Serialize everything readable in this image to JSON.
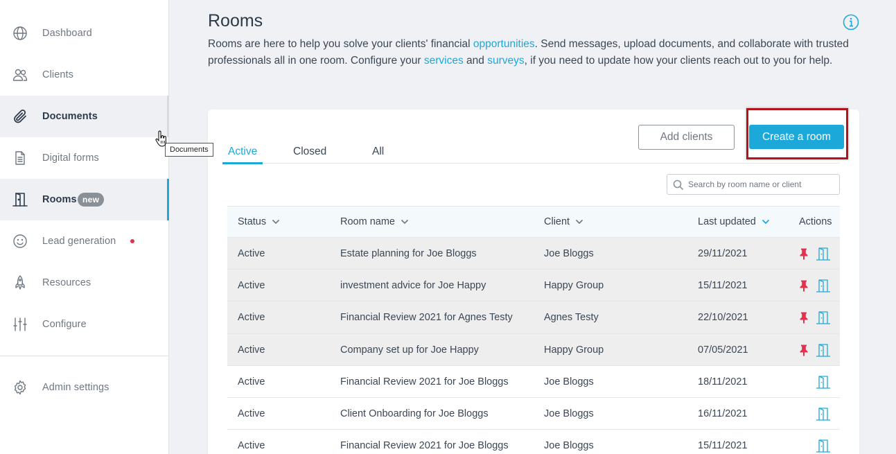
{
  "sidebar": {
    "items": [
      {
        "key": "dashboard",
        "label": "Dashboard",
        "icon": "globe-icon"
      },
      {
        "key": "clients",
        "label": "Clients",
        "icon": "users-icon"
      },
      {
        "key": "documents",
        "label": "Documents",
        "icon": "paperclip-icon",
        "state": "hover"
      },
      {
        "key": "digital-forms",
        "label": "Digital forms",
        "icon": "document-icon"
      },
      {
        "key": "rooms",
        "label": "Rooms",
        "icon": "door-icon",
        "state": "active",
        "badge": "new"
      },
      {
        "key": "lead-generation",
        "label": "Lead generation",
        "icon": "smiley-icon",
        "dot": true
      },
      {
        "key": "resources",
        "label": "Resources",
        "icon": "rocket-icon"
      },
      {
        "key": "configure",
        "label": "Configure",
        "icon": "sliders-icon"
      }
    ],
    "admin": {
      "label": "Admin settings",
      "icon": "gear-icon"
    }
  },
  "tooltip": "Documents",
  "header": {
    "title": "Rooms",
    "intro": {
      "part1": "Rooms are here to help you solve your clients' financial ",
      "link1": "opportunities",
      "part2": ". Send messages, upload documents, and collaborate with trusted professionals all in one room. Configure your ",
      "link2": "services",
      "part3": " and ",
      "link3": "surveys",
      "part4": ", if you need to update how your clients reach out to you for help."
    }
  },
  "tabs": [
    {
      "label": "Active",
      "active": true
    },
    {
      "label": "Closed",
      "active": false
    },
    {
      "label": "All",
      "active": false
    }
  ],
  "buttons": {
    "add_clients": "Add clients",
    "create_room": "Create a room"
  },
  "search": {
    "placeholder": "Search by room name or client",
    "value": ""
  },
  "table": {
    "columns": [
      "Status",
      "Room name",
      "Client",
      "Last updated",
      "Actions"
    ],
    "rows": [
      {
        "status": "Active",
        "room": "Estate planning for Joe Bloggs",
        "client": "Joe Bloggs",
        "updated": "29/11/2021",
        "pinned": true
      },
      {
        "status": "Active",
        "room": "investment advice for Joe Happy",
        "client": "Happy Group",
        "updated": "15/11/2021",
        "pinned": true
      },
      {
        "status": "Active",
        "room": "Financial Review 2021 for Agnes Testy",
        "client": "Agnes Testy",
        "updated": "22/10/2021",
        "pinned": true
      },
      {
        "status": "Active",
        "room": "Company set up for Joe Happy",
        "client": "Happy Group",
        "updated": "07/05/2021",
        "pinned": true
      },
      {
        "status": "Active",
        "room": "Financial Review 2021 for Joe Bloggs",
        "client": "Joe Bloggs",
        "updated": "18/11/2021",
        "pinned": false
      },
      {
        "status": "Active",
        "room": "Client Onboarding for Joe Bloggs",
        "client": "Joe Bloggs",
        "updated": "16/11/2021",
        "pinned": false
      },
      {
        "status": "Active",
        "room": "Financial Review 2021 for Joe Bloggs",
        "client": "Joe Bloggs",
        "updated": "15/11/2021",
        "pinned": false
      }
    ]
  },
  "colors": {
    "accent": "#1ca9d9",
    "pin": "#e0334e",
    "highlight_border": "#b3141c",
    "text": "#3b4754"
  }
}
